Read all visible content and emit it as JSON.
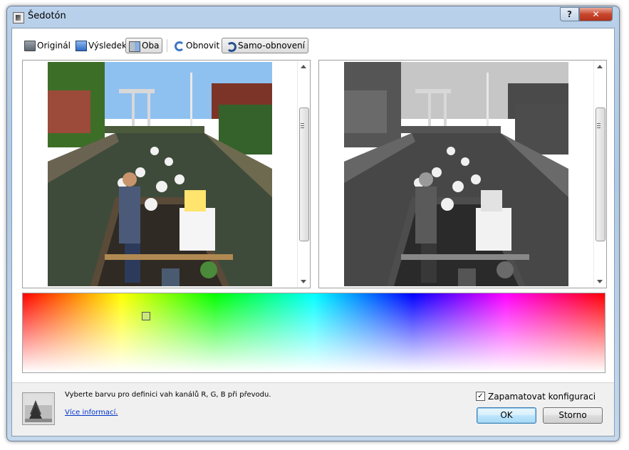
{
  "window": {
    "title": "Šedotón",
    "help_glyph": "?",
    "close_glyph": "✕"
  },
  "toolbar": {
    "original": "Originál",
    "result": "Výsledek",
    "both": "Oba",
    "refresh": "Obnovit",
    "auto_refresh": "Samo-obnovení"
  },
  "footer": {
    "description": "Vyberte barvu pro definici vah kanálů R, G, B při převodu.",
    "more_info": "Více informací",
    "more_info_suffix": ".",
    "remember_config": "Zapamatovat konfiguraci",
    "remember_checked": true,
    "check_glyph": "✓",
    "ok": "OK",
    "cancel": "Storno"
  },
  "colors": {
    "window_frame": "#b9d1ea",
    "link": "#0033cc",
    "ok_button": "#bee6fd"
  },
  "icons": [
    "app-icon",
    "monitor-icon",
    "monitor-blue-icon",
    "split-view-icon",
    "refresh-icon",
    "auto-refresh-icon",
    "checkbox-check-icon"
  ]
}
